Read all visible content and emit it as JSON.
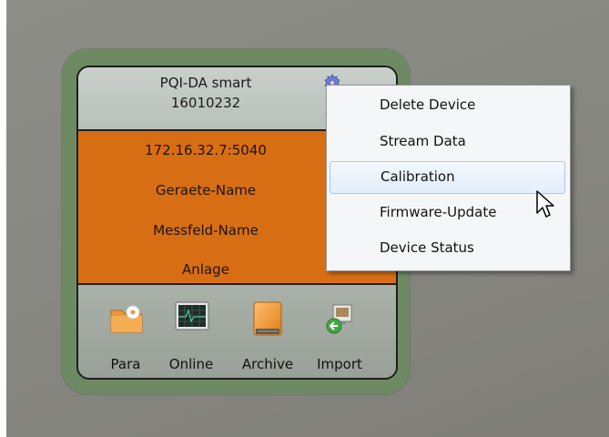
{
  "device": {
    "name": "PQI-DA smart",
    "serial": "16010232",
    "address": "172.16.32.7:5040",
    "device_name": "Geraete-Name",
    "measuring_field": "Messfeld-Name",
    "plant": "Anlage"
  },
  "tile_buttons": [
    {
      "label": "Para",
      "icon": "settings-folder-icon"
    },
    {
      "label": "Online",
      "icon": "monitor-graph-icon"
    },
    {
      "label": "Archive",
      "icon": "archive-drive-icon"
    },
    {
      "label": "Import",
      "icon": "import-arrow-icon"
    }
  ],
  "context_menu": {
    "items": [
      {
        "label": "Delete Device"
      },
      {
        "label": "Stream Data"
      },
      {
        "label": "Calibration",
        "selected": true
      },
      {
        "label": "Firmware-Update"
      },
      {
        "label": "Device Status"
      }
    ]
  },
  "colors": {
    "tile_frame": "#6e8a63",
    "info_panel": "#d86e14",
    "header": "#c9d0cb",
    "menu_highlight": "#a9c7eb"
  }
}
